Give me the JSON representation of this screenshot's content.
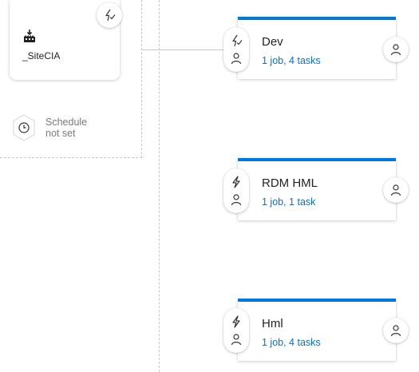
{
  "artifact": {
    "name": "_SiteCIA",
    "icon": "build-artifact-icon",
    "trigger_icon": "continuous-deployment-trigger-icon"
  },
  "schedule": {
    "icon": "clock-icon",
    "line1": "Schedule",
    "line2": "not set"
  },
  "stages": [
    {
      "name": "Dev",
      "jobs": "1 job, 4 tasks",
      "pre_trigger_icon": "trigger-enabled-icon",
      "approver_icon": "person-icon",
      "post_icon": "person-icon"
    },
    {
      "name": "RDM HML",
      "jobs": "1 job, 1 task",
      "pre_trigger_icon": "lightning-icon",
      "approver_icon": "person-icon",
      "post_icon": "person-icon"
    },
    {
      "name": "Hml",
      "jobs": "1 job, 4 tasks",
      "pre_trigger_icon": "lightning-icon",
      "approver_icon": "person-icon",
      "post_icon": "person-icon"
    }
  ],
  "colors": {
    "accent": "#0078d4",
    "link": "#106ebe",
    "muted": "#7a7a7a"
  }
}
